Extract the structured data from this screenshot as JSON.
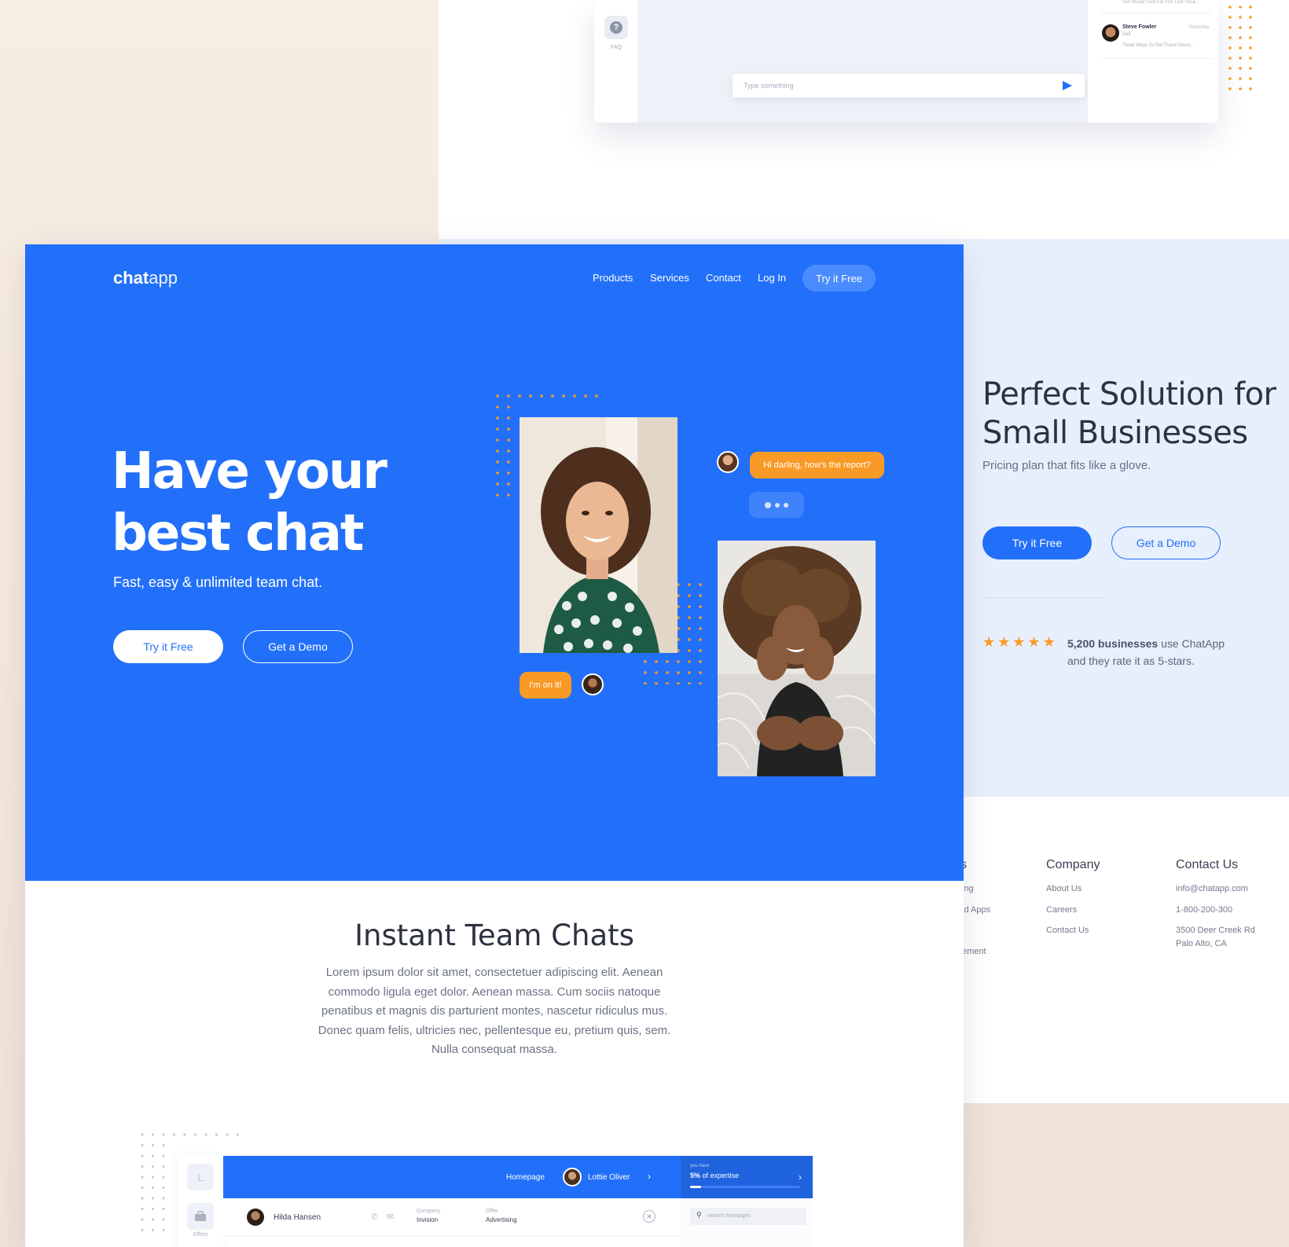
{
  "chat_window": {
    "faq_label": "FAQ",
    "input_placeholder": "Type something",
    "side_cut_text": "Get Ready Fast For Fun Last Vaca...",
    "contact": {
      "name": "Steve Fowler",
      "date": "Yesterday",
      "company": "Dell",
      "preview": "Three Ways To Get Travel Disco..."
    }
  },
  "pricing": {
    "title": "Perfect Solution for Small Businesses",
    "subtitle": "Pricing plan that fits like a glove.",
    "primary_button": "Try it Free",
    "secondary_button": "Get a Demo",
    "rating_stars": 5,
    "rating_bold": "5,200 businesses",
    "rating_rest": " use ChatApp",
    "rating_line2": "and they rate it as 5-stars."
  },
  "footer": {
    "col1_head_partial": "s",
    "col1_links": [
      "ing",
      "id Apps",
      "ement"
    ],
    "company_head": "Company",
    "company_links": [
      "About Us",
      "Careers",
      "Contact Us"
    ],
    "contact_head": "Contact Us",
    "contact_email": "info@chatapp.com",
    "contact_phone": "1-800-200-300",
    "contact_address1": "3500 Deer Creek Rd",
    "contact_address2": "Palo Alto, CA"
  },
  "hero": {
    "logo_bold": "chat",
    "logo_light": "app",
    "nav": [
      "Products",
      "Services",
      "Contact",
      "Log In"
    ],
    "nav_cta": "Try it Free",
    "title_line1": "Have your",
    "title_line2": "best chat",
    "subtitle": "Fast, easy & unlimited team chat.",
    "primary_button": "Try it Free",
    "secondary_button": "Get a Demo",
    "bubble_question": "Hi darling, how's the report?",
    "bubble_answer": "I'm on it!"
  },
  "section": {
    "title": "Instant Team Chats",
    "body": "Lorem ipsum dolor sit amet, consectetuer adipiscing elit. Aenean commodo ligula eget dolor. Aenean massa. Cum sociis natoque penatibus et magnis dis parturient montes, nascetur ridiculus mus. Donec quam felis, ultricies nec, pellentesque eu, pretium quis, sem. Nulla consequat massa."
  },
  "dashboard": {
    "rail_letter": "L",
    "rail_label": "Offers",
    "nav_homepage": "Homepage",
    "user_name": "Lottie Oliver",
    "expertise_small": "you have",
    "expertise_bold": "5%",
    "expertise_rest": " of expertise",
    "expertise_progress": 0.05,
    "row_name": "Hilda Hansen",
    "company_label": "Company",
    "company_value": "Invision",
    "offer_label": "Offer",
    "offer_value": "Advertising",
    "search_placeholder": "search messages"
  },
  "colors": {
    "brand_blue": "#2270f9",
    "accent_orange": "#f99a26",
    "pricing_bg": "#e8effc",
    "text_dark": "#2d3140"
  },
  "icons": [
    "faq-icon",
    "send-icon",
    "star-icon",
    "phone-icon",
    "mail-icon",
    "close-icon",
    "search-icon",
    "briefcase-icon",
    "chevron-right-icon"
  ]
}
